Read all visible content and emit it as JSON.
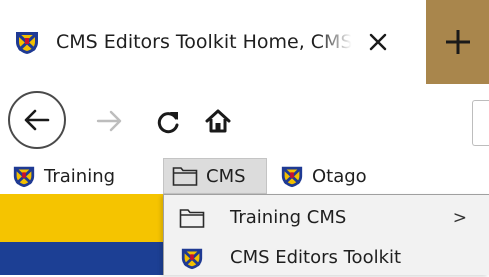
{
  "tab": {
    "title": "CMS Editors Toolkit Home, CMS",
    "close_glyph": "✕",
    "favicon": "crest-icon"
  },
  "newtab": {
    "glyph": "+",
    "color": "#a9864c"
  },
  "nav": {
    "back_icon": "back-arrow-icon",
    "forward_icon": "forward-arrow-icon",
    "reload_icon": "reload-icon",
    "home_icon": "home-icon"
  },
  "bookmarks": [
    {
      "label": "Training",
      "icon": "crest-icon"
    },
    {
      "label": "CMS",
      "icon": "folder-icon"
    },
    {
      "label": "Otago",
      "icon": "crest-icon"
    }
  ],
  "menu": {
    "items": [
      {
        "label": "Training CMS",
        "icon": "folder-icon",
        "submenu_glyph": ">"
      },
      {
        "label": "CMS Editors Toolkit",
        "icon": "crest-icon"
      }
    ]
  },
  "colors": {
    "page_yellow": "#f5c400",
    "page_blue": "#1c3f94",
    "crest_blue": "#1f3a93",
    "crest_gold": "#f3c000"
  }
}
